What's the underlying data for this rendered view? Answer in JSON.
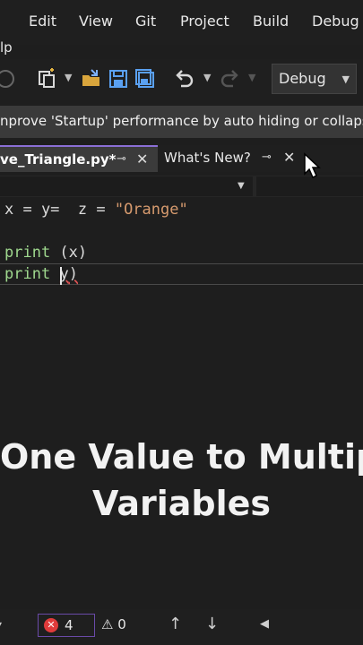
{
  "menu": {
    "items": [
      "Edit",
      "View",
      "Git",
      "Project",
      "Build",
      "Debug"
    ],
    "partial_left": "lp"
  },
  "toolbar": {
    "configuration": "Debug"
  },
  "infobar": {
    "text": "nprove 'Startup' performance by auto hiding or collaps"
  },
  "tabs": [
    {
      "label": "ve_Triangle.py*",
      "active": true
    },
    {
      "label": "What's New?",
      "active": false
    }
  ],
  "editor": {
    "lines": [
      {
        "parts": [
          "x = y=  z = ",
          "\"Orange\""
        ]
      },
      {
        "parts": [
          "print",
          " (x)"
        ]
      },
      {
        "parts": [
          "print",
          " ",
          "y",
          ")"
        ]
      }
    ]
  },
  "caption": {
    "line1": "One Value to Multip",
    "line2": "Variables"
  },
  "status": {
    "errors": "4",
    "warnings": "0"
  },
  "colors": {
    "accent": "#8b6fd6",
    "error": "#e03b3b",
    "keyword": "#9fd88e",
    "string": "#d69a6e"
  }
}
